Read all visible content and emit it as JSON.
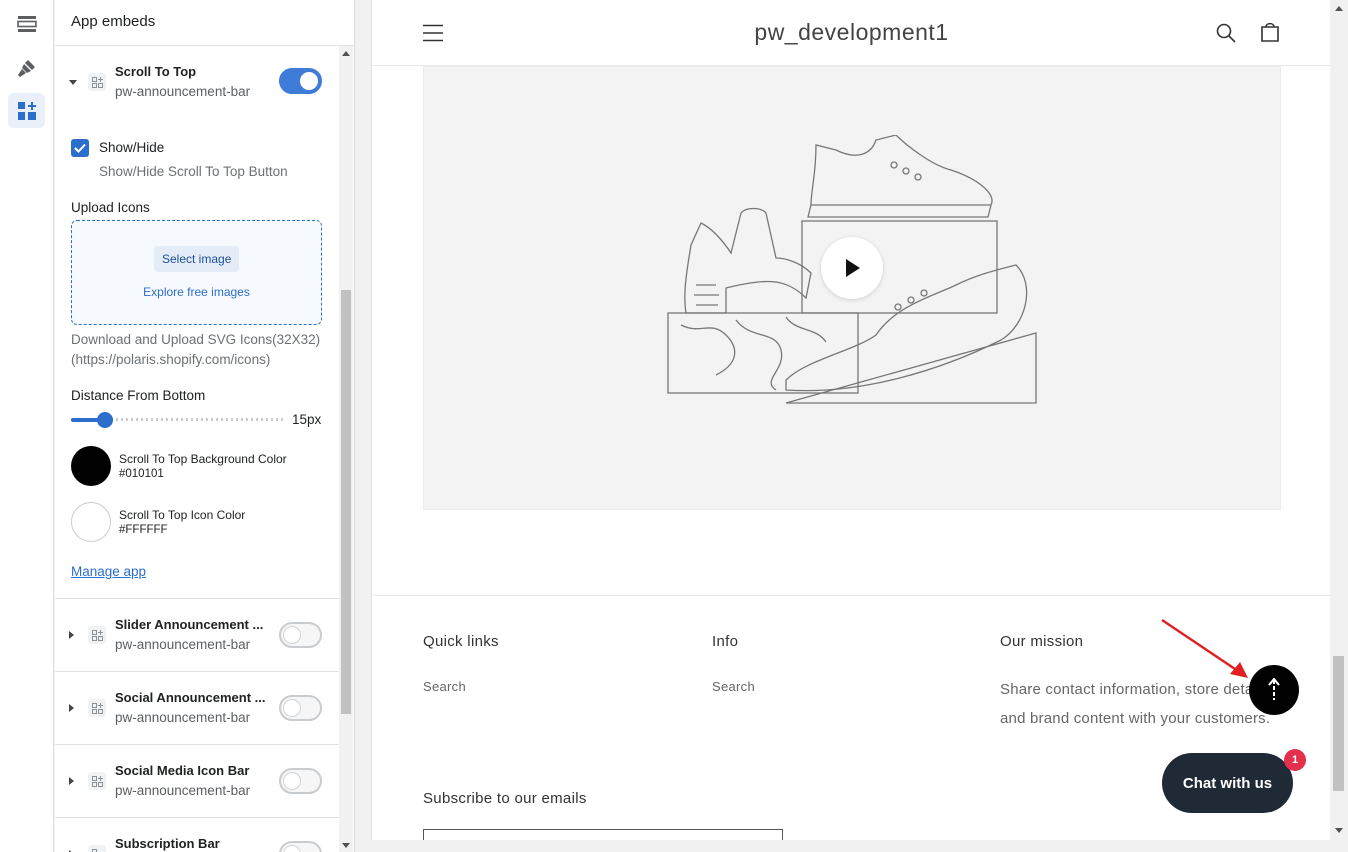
{
  "rail": {
    "items": [
      {
        "icon": "sections-icon",
        "active": false
      },
      {
        "icon": "theme-brush-icon",
        "active": false
      },
      {
        "icon": "app-embeds-icon",
        "active": true
      }
    ]
  },
  "panel": {
    "title": "App embeds",
    "embeds": [
      {
        "title": "Scroll To Top",
        "subtitle": "pw-announcement-bar",
        "enabled": true,
        "expanded": true
      },
      {
        "title": "Slider Announcement ...",
        "subtitle": "pw-announcement-bar",
        "enabled": false,
        "expanded": false
      },
      {
        "title": "Social Announcement ...",
        "subtitle": "pw-announcement-bar",
        "enabled": false,
        "expanded": false
      },
      {
        "title": "Social Media Icon Bar",
        "subtitle": "pw-announcement-bar",
        "enabled": false,
        "expanded": false
      },
      {
        "title": "Subscription Bar",
        "subtitle": "",
        "enabled": false,
        "expanded": false
      }
    ],
    "settings": {
      "show_hide_label": "Show/Hide",
      "show_hide_help": "Show/Hide Scroll To Top Button",
      "show_hide_checked": true,
      "upload_label": "Upload Icons",
      "select_image": "Select image",
      "explore_images": "Explore free images",
      "upload_help_1": "Download and Upload SVG Icons(32X32)",
      "upload_help_2": "(https://polaris.shopify.com/icons)",
      "distance_label": "Distance From Bottom",
      "distance_value": "15px",
      "bg_color_label": "Scroll To Top Background Color",
      "bg_color_value": "#010101",
      "icon_color_label": "Scroll To Top Icon Color",
      "icon_color_value": "#FFFFFF",
      "manage_app": "Manage app"
    }
  },
  "preview": {
    "store_name": "pw_development1",
    "footer": {
      "quick_links_heading": "Quick links",
      "quick_links_item": "Search",
      "info_heading": "Info",
      "info_item": "Search",
      "mission_heading": "Our mission",
      "mission_text": "Share contact information, store details, and brand content with your customers.",
      "subscribe_heading": "Subscribe to our emails"
    },
    "chat_label": "Chat with us",
    "chat_badge": "1"
  },
  "colors": {
    "accent": "#2c6ecb",
    "scroll_top_bg": "#010101",
    "chat_bg": "#1f2a36",
    "badge": "#e3314d",
    "annotation_arrow": "#e02020"
  }
}
